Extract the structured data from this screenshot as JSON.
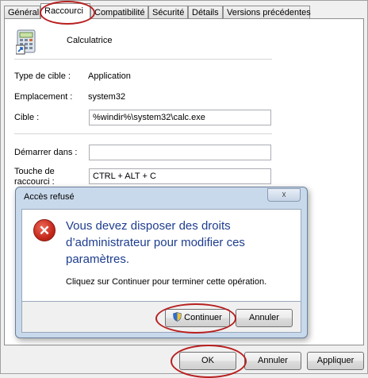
{
  "tabs": [
    "Général",
    "Raccourci",
    "Compatibilité",
    "Sécurité",
    "Détails",
    "Versions précédentes"
  ],
  "app_name": "Calculatrice",
  "properties": {
    "target_type_label": "Type de cible :",
    "target_type_value": "Application",
    "location_label": "Emplacement :",
    "location_value": "system32",
    "target_label": "Cible :",
    "target_value": "%windir%\\system32\\calc.exe",
    "start_in_label": "Démarrer dans :",
    "start_in_value": "",
    "shortcut_key_label": "Touche de raccourci :",
    "shortcut_key_value": "CTRL + ALT + C"
  },
  "dialog": {
    "title": "Accès refusé",
    "close_glyph": "☓",
    "main_message": "Vous devez disposer des droits d’administrateur pour modifier ces paramètres.",
    "sub_message": "Cliquez sur Continuer pour terminer cette opération.",
    "continue_label": "Continuer",
    "cancel_label": "Annuler"
  },
  "buttons": {
    "ok_label": "OK",
    "cancel_label": "Annuler",
    "apply_label": "Appliquer"
  },
  "colors": {
    "highlight_oval": "#b81f1f",
    "dialog_message": "#1e3d8f"
  }
}
